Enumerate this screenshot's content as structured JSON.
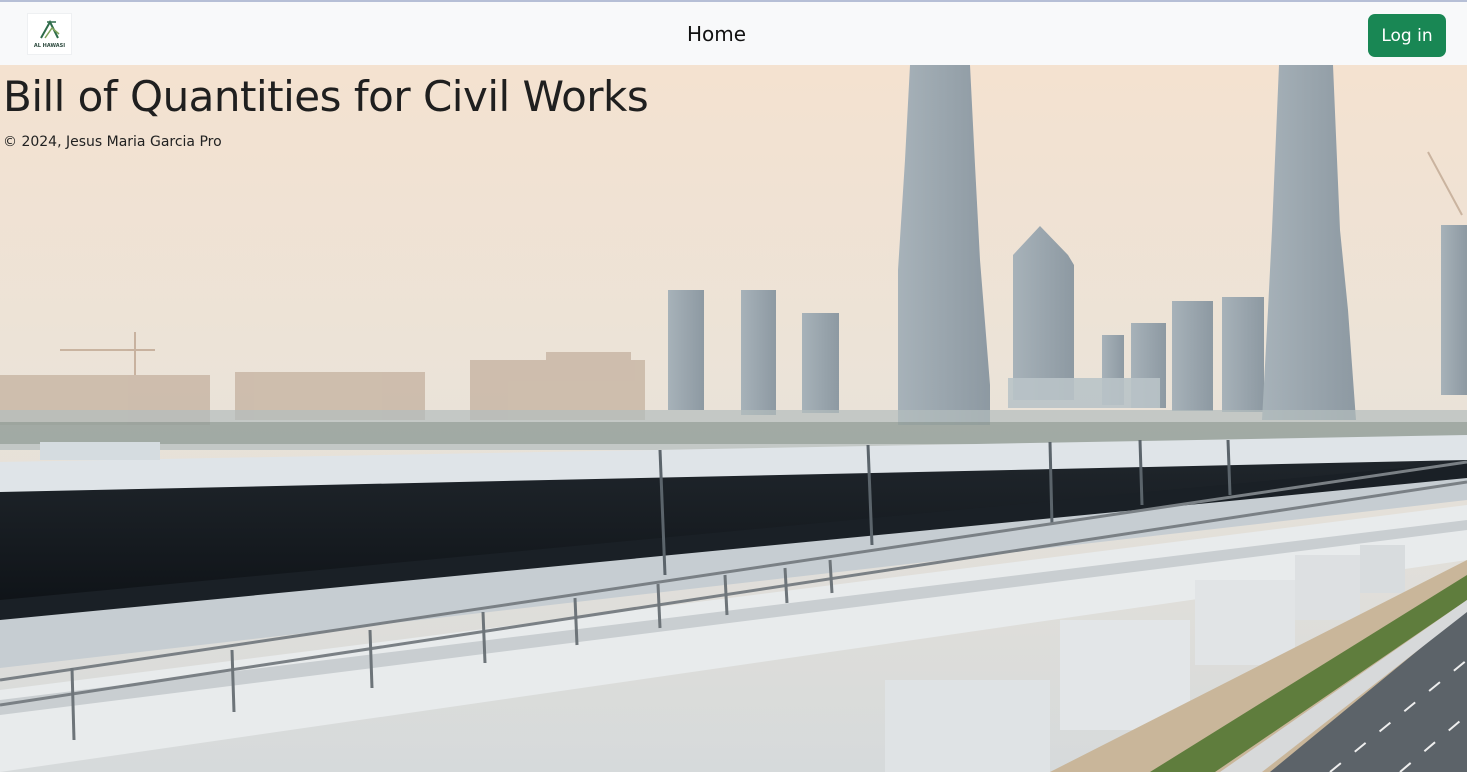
{
  "nav": {
    "logo_text": "AL HAWASI",
    "home_label": "Home",
    "login_label": "Log in",
    "login_color": "#198754"
  },
  "hero": {
    "title": "Bill of Quantities for Civil Works",
    "copyright": "© 2024, Jesus Maria Garcia Pro"
  }
}
